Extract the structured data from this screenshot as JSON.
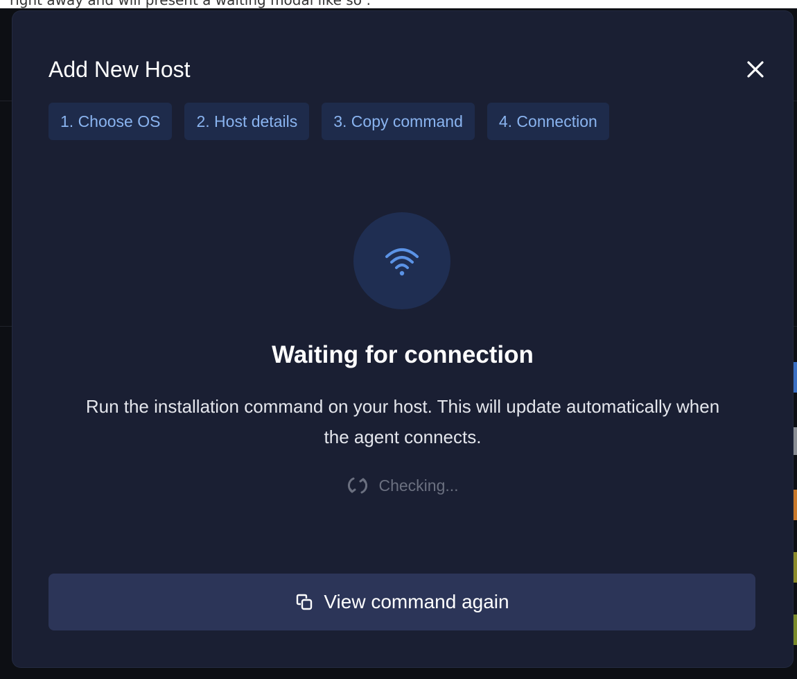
{
  "background": {
    "top_text": "right away and will present a waiting modal like so :"
  },
  "modal": {
    "title": "Add New Host",
    "close_icon": "close-icon",
    "steps": [
      {
        "label": "1. Choose OS"
      },
      {
        "label": "2. Host details"
      },
      {
        "label": "3. Copy command"
      },
      {
        "label": "4. Connection"
      }
    ],
    "status": {
      "icon": "wifi-icon",
      "title": "Waiting for connection",
      "description": "Run the installation command on your host. This will update automatically when the agent connects.",
      "checking_icon": "refresh-icon",
      "checking_label": "Checking..."
    },
    "view_command_button": {
      "icon": "copy-icon",
      "label": "View command again"
    }
  },
  "colors": {
    "modal_bg": "#1a1f33",
    "step_bg": "#1e2b4b",
    "step_text": "#8ab4f0",
    "accent_blue": "#5b93e6",
    "button_bg": "#2c3558"
  }
}
